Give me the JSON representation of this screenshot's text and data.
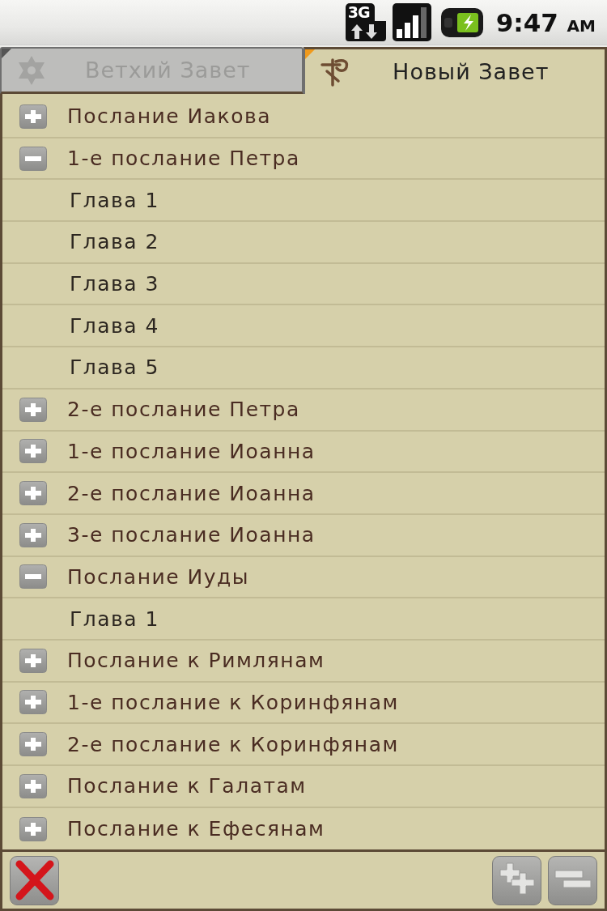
{
  "status_bar": {
    "network_type": "3G",
    "time": "9:47",
    "meridiem": "AM"
  },
  "tabs": [
    {
      "label": "Ветхий Завет",
      "selected": false
    },
    {
      "label": "Новый Завет",
      "selected": true
    }
  ],
  "tree": [
    {
      "label": "Послание Иакова",
      "expanded": false
    },
    {
      "label": "1-е послание Петра",
      "expanded": true,
      "children": [
        {
          "label": "Глава 1"
        },
        {
          "label": "Глава 2"
        },
        {
          "label": "Глава 3"
        },
        {
          "label": "Глава 4"
        },
        {
          "label": "Глава 5"
        }
      ]
    },
    {
      "label": "2-е послание Петра",
      "expanded": false
    },
    {
      "label": "1-е послание Иоанна",
      "expanded": false
    },
    {
      "label": "2-е послание Иоанна",
      "expanded": false
    },
    {
      "label": "3-е послание Иоанна",
      "expanded": false
    },
    {
      "label": "Послание Иуды",
      "expanded": true,
      "children": [
        {
          "label": "Глава 1"
        }
      ]
    },
    {
      "label": "Послание к Римлянам",
      "expanded": false
    },
    {
      "label": "1-е послание к Коринфянам",
      "expanded": false
    },
    {
      "label": "2-е послание к Коринфянам",
      "expanded": false
    },
    {
      "label": "Послание к Галатам",
      "expanded": false
    },
    {
      "label": "Послание к Ефесянам",
      "expanded": false
    }
  ]
}
